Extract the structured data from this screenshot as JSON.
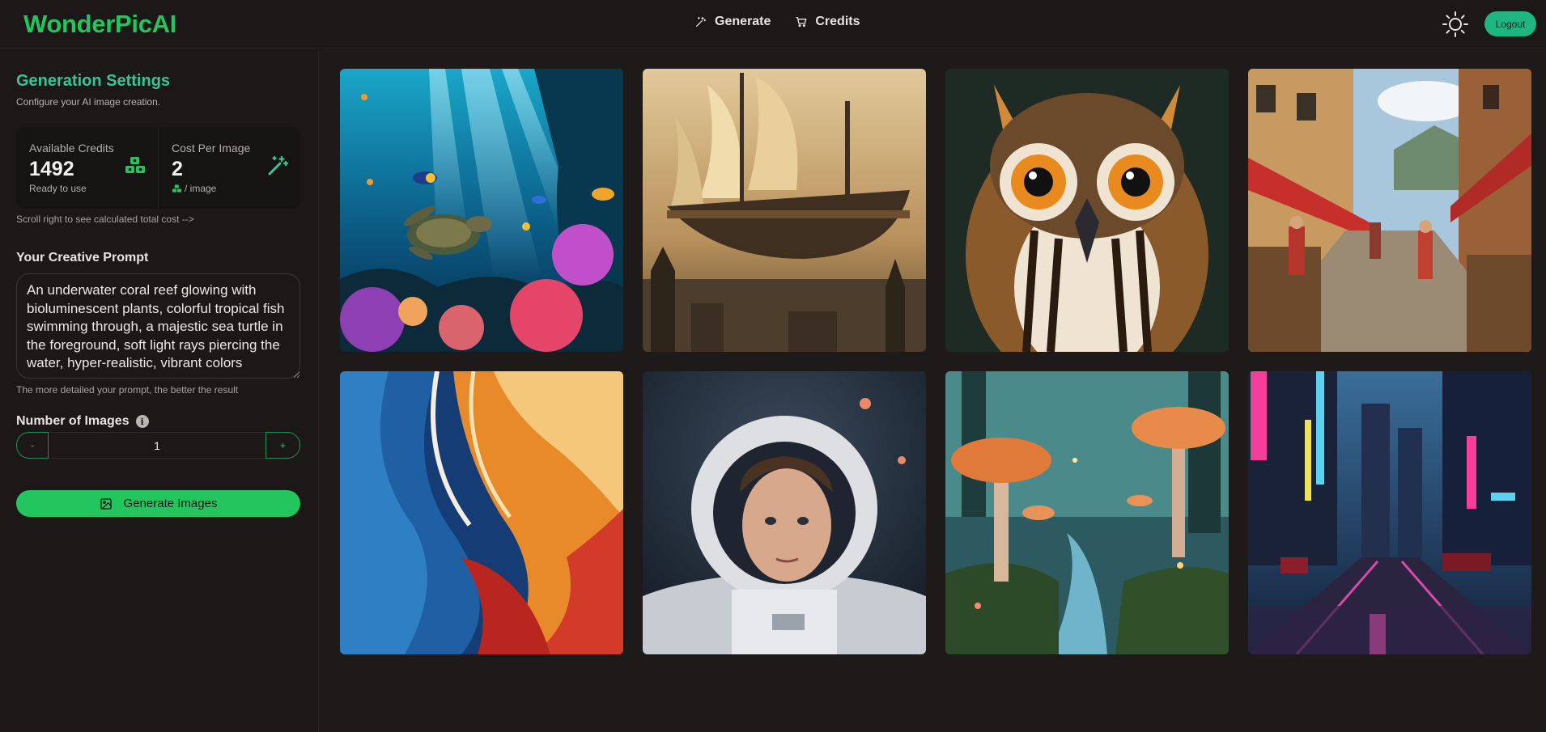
{
  "header": {
    "brand": "WonderPicAI",
    "nav": [
      {
        "label": "Generate",
        "icon": "magic-wand-icon"
      },
      {
        "label": "Credits",
        "icon": "cart-icon"
      }
    ],
    "theme_icon": "sun-icon",
    "logout_label": "Logout"
  },
  "sidebar": {
    "title": "Generation Settings",
    "subtitle": "Configure your AI image creation.",
    "credits": {
      "available_label": "Available Credits",
      "available_value": "1492",
      "available_note": "Ready to use",
      "cost_label": "Cost Per Image",
      "cost_value": "2",
      "cost_note": "/ image"
    },
    "scroll_hint": "Scroll right to see calculated total cost -->",
    "prompt_label": "Your Creative Prompt",
    "prompt_value": "An underwater coral reef glowing with bioluminescent plants, colorful tropical fish swimming through, a majestic sea turtle in the foreground, soft light rays piercing the water, hyper-realistic, vibrant colors",
    "prompt_hint": "The more detailed your prompt, the better the result",
    "num_images_label": "Number of Images",
    "num_images_value": "1",
    "minus_label": "-",
    "plus_label": "+",
    "generate_label": "Generate Images"
  },
  "gallery": {
    "images": [
      {
        "name": "underwater-coral-reef-image"
      },
      {
        "name": "flying-airship-image"
      },
      {
        "name": "owl-portrait-image"
      },
      {
        "name": "medieval-market-street-image"
      },
      {
        "name": "abstract-color-waves-image"
      },
      {
        "name": "astronaut-portrait-image"
      },
      {
        "name": "enchanted-mushroom-forest-image"
      },
      {
        "name": "neon-city-street-image"
      }
    ]
  },
  "colors": {
    "accent": "#22c55e",
    "teal": "#34c59c",
    "background": "#1d1a19"
  }
}
